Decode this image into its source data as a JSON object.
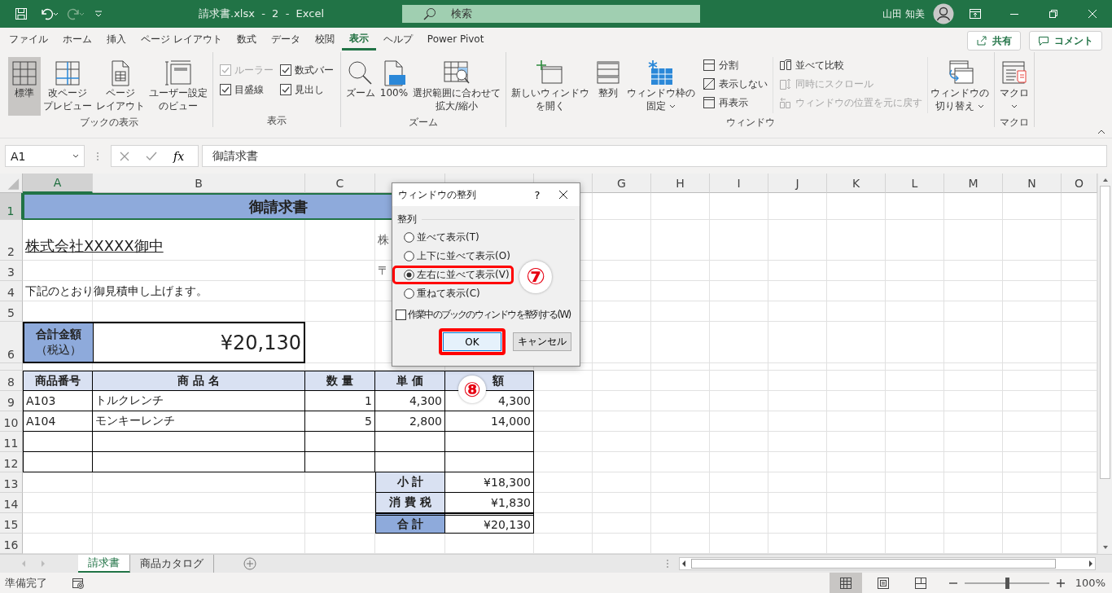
{
  "title_bar": {
    "title": "請求書.xlsx  -  2  -  Excel",
    "search": {
      "placeholder": "検索"
    },
    "user": "山田 知美"
  },
  "menu": {
    "tabs": [
      {
        "label": "ファイル",
        "selected": false
      },
      {
        "label": "ホーム",
        "selected": false
      },
      {
        "label": "挿入",
        "selected": false
      },
      {
        "label": "ページ レイアウト",
        "selected": false
      },
      {
        "label": "数式",
        "selected": false
      },
      {
        "label": "データ",
        "selected": false
      },
      {
        "label": "校閲",
        "selected": false
      },
      {
        "label": "表示",
        "selected": true
      },
      {
        "label": "ヘルプ",
        "selected": false
      },
      {
        "label": "Power Pivot",
        "selected": false
      }
    ],
    "share": "共有",
    "comment": "コメント"
  },
  "ribbon": {
    "groups": [
      {
        "label": "ブックの表示",
        "items": [
          {
            "kind": "large",
            "lines": [
              "標準"
            ],
            "selected": true
          },
          {
            "kind": "large",
            "lines": [
              "改ページ",
              "プレビュー"
            ],
            "selected": false
          },
          {
            "kind": "large",
            "lines": [
              "ページ",
              "レイアウト"
            ],
            "selected": false
          },
          {
            "kind": "large",
            "lines": [
              "ユーザー設定",
              "のビュー"
            ],
            "selected": false
          }
        ]
      },
      {
        "label": "表示",
        "items": [
          {
            "kind": "check",
            "label": "ルーラー",
            "checked": true,
            "disabled": true
          },
          {
            "kind": "check",
            "label": "目盛線",
            "checked": true,
            "disabled": false
          },
          {
            "kind": "check",
            "label": "数式バー",
            "checked": true,
            "disabled": false
          },
          {
            "kind": "check",
            "label": "見出し",
            "checked": true,
            "disabled": false
          }
        ]
      },
      {
        "label": "ズーム",
        "items": [
          {
            "kind": "large",
            "lines": [
              "ズーム"
            ],
            "selected": false
          },
          {
            "kind": "large",
            "lines": [
              "100%"
            ],
            "selected": false
          },
          {
            "kind": "large",
            "lines": [
              "選択範囲に合わせて",
              "拡大/縮小"
            ],
            "selected": false
          }
        ]
      },
      {
        "label": "ウィンドウ",
        "items": [
          {
            "kind": "large",
            "lines": [
              "新しいウィンドウ",
              "を開く"
            ],
            "selected": false
          },
          {
            "kind": "large",
            "lines": [
              "整列"
            ],
            "selected": false
          },
          {
            "kind": "large",
            "lines": [
              "ウィンドウ枠の",
              "固定"
            ],
            "selected": false,
            "dropdown": true
          },
          {
            "kind": "small",
            "label": "分割",
            "disabled": false
          },
          {
            "kind": "small",
            "label": "表示しない",
            "disabled": false
          },
          {
            "kind": "small",
            "label": "再表示",
            "disabled": false
          },
          {
            "kind": "small",
            "label": "並べて比較",
            "disabled": false
          },
          {
            "kind": "small",
            "label": "同時にスクロール",
            "disabled": true
          },
          {
            "kind": "small",
            "label": "ウィンドウの位置を元に戻す",
            "disabled": true
          },
          {
            "kind": "large",
            "lines": [
              "ウィンドウの",
              "切り替え"
            ],
            "selected": false,
            "dropdown": true
          }
        ]
      },
      {
        "label": "マクロ",
        "items": [
          {
            "kind": "large",
            "lines": [
              "マクロ"
            ],
            "selected": false,
            "dropdown": true
          }
        ]
      }
    ]
  },
  "formula_bar": {
    "name_box": "A1",
    "insert_function": "fx",
    "formula": "御請求書"
  },
  "sheet": {
    "columns": [
      {
        "label": "A",
        "selected": true
      },
      {
        "label": "B",
        "selected": false
      },
      {
        "label": "C",
        "selected": false
      },
      {
        "selected": false
      },
      {
        "selected": false
      },
      {
        "selected": false
      },
      {
        "label": "G",
        "selected": false
      },
      {
        "label": "H",
        "selected": false
      },
      {
        "label": "I",
        "selected": false
      },
      {
        "label": "J",
        "selected": false
      },
      {
        "label": "K",
        "selected": false
      },
      {
        "label": "L",
        "selected": false
      },
      {
        "label": "M",
        "selected": false
      },
      {
        "label": "N",
        "selected": false
      },
      {
        "label": "O",
        "selected": false
      }
    ],
    "rows": [
      {
        "label": "1",
        "selected": true,
        "cells": [
          "御請求書"
        ]
      },
      {
        "label": "2",
        "selected": false,
        "cells": [
          "株式会社XXXXX御中",
          "株"
        ]
      },
      {
        "label": "3",
        "selected": false,
        "cells": [
          "〒"
        ]
      },
      {
        "label": "4",
        "selected": false,
        "cells": [
          "下記のとおり御見積申し上げます。"
        ]
      },
      {
        "label": "5",
        "selected": false
      },
      {
        "label": "6",
        "selected": false,
        "cells": [
          "合計金額",
          "（税込）",
          "¥20,130"
        ]
      },
      {
        "label": "8",
        "selected": false,
        "cells": [
          "商品番号",
          "商 品 名",
          "数 量",
          "単 価",
          "額"
        ]
      },
      {
        "label": "9",
        "selected": false,
        "cells": [
          "A103",
          "トルクレンチ",
          "1",
          "4,300",
          "4,300"
        ]
      },
      {
        "label": "10",
        "selected": false,
        "cells": [
          "A104",
          "モンキーレンチ",
          "5",
          "2,800",
          "14,000"
        ]
      },
      {
        "label": "11",
        "selected": false
      },
      {
        "label": "12",
        "selected": false
      },
      {
        "label": "13",
        "selected": false,
        "cells": [
          "小 計",
          "¥18,300"
        ]
      },
      {
        "label": "14",
        "selected": false,
        "cells": [
          "消 費 税",
          "¥1,830"
        ]
      },
      {
        "label": "15",
        "selected": false,
        "cells": [
          "合 計",
          "¥20,130"
        ]
      },
      {
        "label": "16",
        "selected": false
      }
    ]
  },
  "dialog": {
    "title": "ウィンドウの整列",
    "help": "?",
    "group": "整列",
    "options": [
      {
        "label": "並べて表示(T)",
        "selected": false,
        "highlighted": false
      },
      {
        "label": "上下に並べて表示(O)",
        "selected": false,
        "highlighted": false
      },
      {
        "label": "左右に並べて表示(V)",
        "selected": true,
        "highlighted": true
      },
      {
        "label": "重ねて表示(C)",
        "selected": false,
        "highlighted": false
      }
    ],
    "checkbox": {
      "label": "作業中のブックのウィンドウを整列する(W)",
      "checked": false
    },
    "buttons": [
      {
        "label": "OK",
        "highlighted": true
      },
      {
        "label": "キャンセル",
        "highlighted": false
      }
    ]
  },
  "annotations": [
    {
      "label": "⑦"
    },
    {
      "label": "⑧"
    }
  ],
  "sheet_tabs": [
    {
      "label": "請求書",
      "selected": true
    },
    {
      "label": "商品カタログ",
      "selected": false
    }
  ],
  "status_bar": {
    "status": "準備完了",
    "views": [
      {
        "kind": "normal",
        "selected": true
      },
      {
        "kind": "page_layout",
        "selected": false
      },
      {
        "kind": "page_break",
        "selected": false
      }
    ],
    "zoom": {
      "level": 0.5,
      "reading": "100%"
    }
  }
}
